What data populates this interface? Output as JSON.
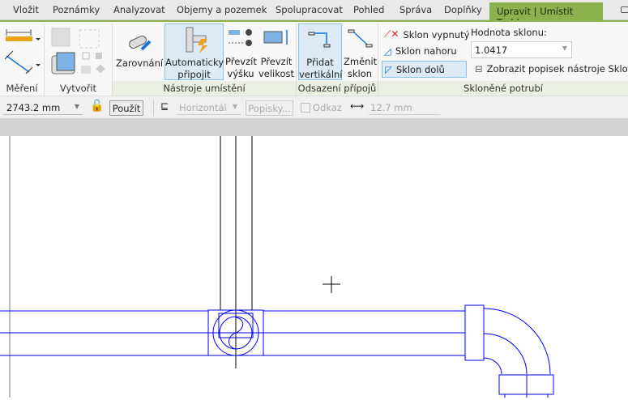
{
  "tabs": [
    "Vložit",
    "Poznámky",
    "Analyzovat",
    "Objemy a pozemek",
    "Spolupracovat",
    "Pohled",
    "Správa",
    "Doplňky"
  ],
  "active_tab": "Upravit | Umístit Trubka",
  "panels": {
    "mereni": "Měření",
    "vytvorit": "Vytvořit",
    "nastroje": "Nástroje umístění",
    "odsazeni": "Odsazení přípojů",
    "sklonene": "Skloněné potrubí"
  },
  "buttons": {
    "zarovnani": "Zarovnání",
    "auto_line1": "Automaticky",
    "auto_line2": "připojit",
    "prevzit_vysku_1": "Převzít",
    "prevzit_vysku_2": "výšku",
    "prevzit_vel_1": "Převzít",
    "prevzit_vel_2": "velikost",
    "pridat_1": "Přidat",
    "pridat_2": "vertikální",
    "zmenit_1": "Změnit",
    "zmenit_2": "sklon",
    "sklon_vypnuty": "Sklon vypnutý",
    "sklon_nahoru": "Sklon nahoru",
    "sklon_dolu": "Sklon dolů",
    "hodnota_label": "Hodnota sklonu:",
    "hodnota_value": "1.0417",
    "zobrazit_popisek": "Zobrazit popisek nástroje Sklon"
  },
  "options": {
    "offset_value": "2743.2 mm",
    "apply": "Použít",
    "justification": "Horizontál",
    "tags": "Popisky...",
    "reference": "Odkaz",
    "width_value": "12.7 mm"
  },
  "colors": {
    "accent": "#8cb24f",
    "pipe": "#0000ff"
  }
}
